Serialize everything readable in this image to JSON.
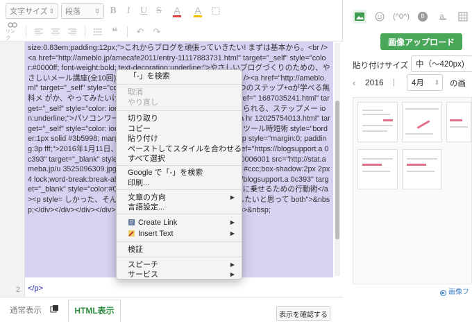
{
  "toolbar": {
    "font_size_label": "文字サイズ",
    "paragraph_label": "段落",
    "bold": "B",
    "italic": "I",
    "underline": "U",
    "strike": "S",
    "color_a": "A",
    "bg_a": "A",
    "link_label": "リンク"
  },
  "code": {
    "line_numbers": [
      "2"
    ],
    "line1": "size:0.83em;padding:12px;\">これからブログを頑張っていきたい! まずは基本から。<br /><a href=\"http://ameblo.jp/amecafe2011/entry-11117883731.html\" target=\"_self\" style=\"color:#0000ff; font-weight:bold; text-decoration:underline;\">やさしいブログづくりのための、やさしいメール講座(全10回)</a> れるイベントにするために。<br /><a href=\"http://ameblo. ml\" target=\"_self\" style=\"color: =\"少人数イベント実施のための5つのステップ+αが学べる無料メ がか、やってみたいけどうすればっ?という方へ<br /><a href=\" 1687035241.html\" target=\"_self\" style=\"color: ion:underline;\">初めてでも安心して始められる、ステップメー ion:underline;\">パソコンワーク、もっと時短できますよ。<br /><a hr 12025754013.html\" target=\"_self\" style=\"color: ion:underline;\">ブロガーさんのための、ツール時短術 style=\"border:1px solid #3b5998; margin:0 8px; pa #cccccc 3px 3px 3px;\"><p style=\"margin:0; padding:3p fff;\">2016年1月11日、出版しました!</div><div style=\"pa href=\"https://blogsupport.a 0c393\" target=\"_blank\" style=\"color:#0000ff; font-w 11/c1/bd/j/o080006001 src=\"http://stat.ameba.jp/u 3525096309.jpg\" style=\"w ;padding:0;border:1px solid #ccc;box-shadow:2px 2px 4 lock;word-break:break-all;padding-left:45%;text-al href=\"https://blogsupport.a 0c393\" target=\"_blank\" style=\"color:#0000ff; font-w ブログでビジネスを軌道に乗せるための行動術</a><p style= しかった、そんな気持ちを一人でも多くの人と共有したいと思って both\">&nbsp;</div></div></div></div><!-- mini --></div><!-- line-height --><p>&nbsp;",
    "line2_num": "2",
    "line2": "</p>"
  },
  "tabs": {
    "normal": "通常表示",
    "html": "HTML表示",
    "confirm": "表示を確認する"
  },
  "right": {
    "upload": "画像アップロード",
    "size_label": "貼り付けサイズ",
    "size_value": "中（～420px)",
    "year": "2016",
    "month": "4月",
    "month_suffix": "の画",
    "fold": "画像フ",
    "tabs": [
      "(^0^)",
      "a.",
      "B"
    ]
  },
  "menu": {
    "search": "「-」を検索",
    "undo": "取消",
    "redo": "やり直し",
    "cut": "切り取り",
    "copy": "コピー",
    "paste": "貼り付け",
    "paste_match": "ペーストしてスタイルを合わせる",
    "select_all": "すべて選択",
    "google": "Google で「-」を検索",
    "print": "印刷...",
    "direction": "文章の方向",
    "lang": "言語設定...",
    "create_link": "Create Link",
    "insert_text": "Insert Text",
    "inspect": "検証",
    "speech": "スピーチ",
    "services": "サービス"
  },
  "colors": {
    "accent_green": "#49a759",
    "code_bg": "#d6d2f2",
    "html_tab": "#2a8a3e"
  }
}
